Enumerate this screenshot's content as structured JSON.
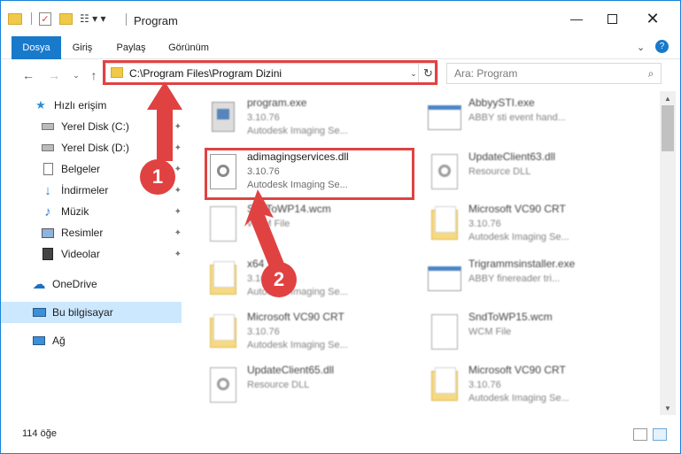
{
  "window": {
    "title": "Program",
    "accent_color": "#1979ca",
    "highlight_color": "#e04242"
  },
  "ribbon": {
    "tabs": [
      "Dosya",
      "Giriş",
      "Paylaş",
      "Görünüm"
    ]
  },
  "address": {
    "path": "C:\\Program Files\\Program Dizini",
    "search_placeholder": "Ara: Program"
  },
  "sidebar": {
    "items": [
      {
        "label": "Hızlı erişim",
        "icon": "star-icon"
      },
      {
        "label": "Yerel Disk (C:)",
        "icon": "drive-icon"
      },
      {
        "label": "Yerel Disk (D:)",
        "icon": "drive-icon"
      },
      {
        "label": "Belgeler",
        "icon": "documents-icon"
      },
      {
        "label": "İndirmeler",
        "icon": "download-icon"
      },
      {
        "label": "Müzik",
        "icon": "music-icon"
      },
      {
        "label": "Resimler",
        "icon": "pictures-icon"
      },
      {
        "label": "Videolar",
        "icon": "videos-icon"
      },
      {
        "label": "OneDrive",
        "icon": "cloud-icon"
      },
      {
        "label": "Bu bilgisayar",
        "icon": "computer-icon"
      },
      {
        "label": "Ağ",
        "icon": "network-icon"
      }
    ]
  },
  "files": [
    {
      "name": "program.exe",
      "version": "3.10.76",
      "desc": "Autodesk Imaging Se...",
      "type": "exe"
    },
    {
      "name": "AbbyySTI.exe",
      "version": "",
      "desc": "ABBY sti event hand...",
      "type": "exe-window"
    },
    {
      "name": "adimagingservices.dll",
      "version": "3.10.76",
      "desc": "Autodesk Imaging Se...",
      "type": "dll"
    },
    {
      "name": "UpdateClient63.dll",
      "version": "",
      "desc": "Resource DLL",
      "type": "dll"
    },
    {
      "name": "SndToWP14.wcm",
      "version": "",
      "desc": "WCM File",
      "type": "file"
    },
    {
      "name": "Microsoft VC90 CRT",
      "version": "3.10.76",
      "desc": "Autodesk Imaging Se...",
      "type": "folder"
    },
    {
      "name": "x64",
      "version": "3.10.76",
      "desc": "Autodesk Imaging Se...",
      "type": "folder"
    },
    {
      "name": "Trigrammsinstaller.exe",
      "version": "",
      "desc": "ABBY finereader tri...",
      "type": "exe-window"
    },
    {
      "name": "Microsoft VC90 CRT",
      "version": "3.10.76",
      "desc": "Autodesk Imaging Se...",
      "type": "folder"
    },
    {
      "name": "SndToWP15.wcm",
      "version": "",
      "desc": "WCM File",
      "type": "file"
    },
    {
      "name": "UpdateClient65.dll",
      "version": "",
      "desc": "Resource DLL",
      "type": "dll"
    },
    {
      "name": "Microsoft VC90 CRT",
      "version": "3.10.76",
      "desc": "Autodesk Imaging Se...",
      "type": "folder"
    }
  ],
  "status": {
    "count": "114 öğe"
  },
  "annotations": {
    "step1": "1",
    "step2": "2"
  }
}
